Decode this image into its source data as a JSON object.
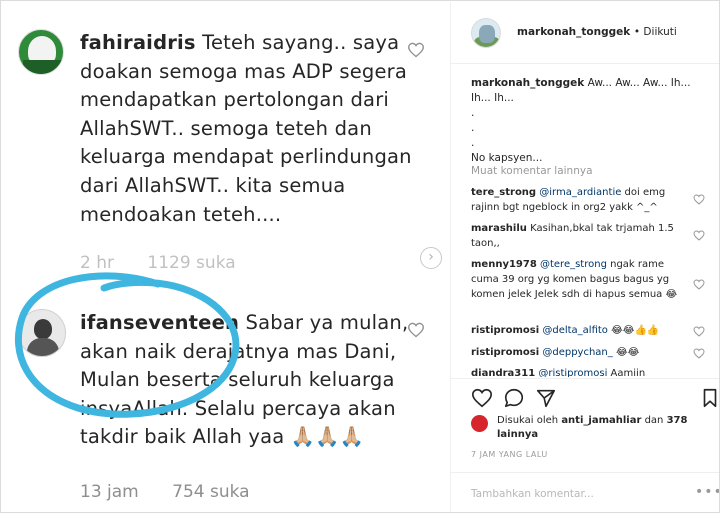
{
  "comments": [
    {
      "username": "fahiraidris",
      "text": "Teteh sayang.. saya doakan semoga mas ADP segera mendapatkan pertolongan dari AllahSWT.. semoga teteh dan keluarga mendapat perlindungan dari AllahSWT.. kita semua mendoakan teteh....",
      "time": "2 hr",
      "likes": "1129 suka"
    },
    {
      "username": "ifanseventeen",
      "text": "Sabar ya mulan, akan naik derajatnya mas Dani, Mulan beserta seluruh keluarga insyaAllah. Selalu percaya akan takdir baik Allah yaa 🙏🏼🙏🏼🙏🏼",
      "time": "13 jam",
      "likes": "754 suka"
    }
  ],
  "post": {
    "username": "markonah_tonggek",
    "follow_status": "• Diikuti",
    "caption_user": "markonah_tonggek",
    "caption_text": "Aw... Aw... Aw... Ih... Ih... Ih...",
    "caption_dots": [
      ".",
      ".",
      "."
    ],
    "caption_tail": "No kapsyen...",
    "more_comments": "Muat komentar lainnya",
    "comments": [
      {
        "user": "tere_strong",
        "mention": "@irma_ardiantie",
        "text": " doi emg rajinn bgt ngeblock in org2 yakk ^_^"
      },
      {
        "user": "marashilu",
        "mention": "",
        "text": "Kasihan,bkal tak trjamah 1.5 taon,,"
      },
      {
        "user": "menny1978",
        "mention": "@tere_strong",
        "text": " ngak rame cuma 39 org yg komen bagus bagus yg komen jelek Jelek sdh di hapus semua 😂"
      },
      {
        "user": "ristipromosi",
        "mention": "@delta_alfito",
        "text": " 😂😂👍👍"
      },
      {
        "user": "ristipromosi",
        "mention": "@deppychan_",
        "text": " 😂😂"
      },
      {
        "user": "diandra311",
        "mention": "@ristipromosi",
        "text": " Aamiin"
      }
    ],
    "liked_by_prefix": "Disukai oleh",
    "liked_by_user": "anti_jamahliar",
    "liked_by_mid": " dan",
    "liked_by_count": "378 lainnya",
    "timestamp": "7 JAM YANG LALU",
    "comment_placeholder": "Tambahkan komentar...",
    "more_icon_text": "•••"
  },
  "colors": {
    "highlight_circle": "#3fb6e0",
    "mention": "#003569",
    "muted": "#999999"
  }
}
